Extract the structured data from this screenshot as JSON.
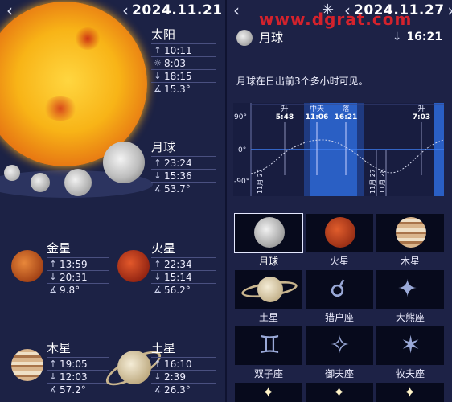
{
  "left": {
    "date": "2024.11.21",
    "sun": {
      "name": "太阳",
      "rise": "10:11",
      "transit": "8:03",
      "set": "18:15",
      "alt": "15.3°"
    },
    "moon": {
      "name": "月球",
      "rise": "23:24",
      "set": "15:36",
      "alt": "53.7°"
    },
    "venus": {
      "name": "金星",
      "rise": "13:59",
      "set": "20:31",
      "alt": "9.8°"
    },
    "mars": {
      "name": "火星",
      "rise": "22:34",
      "set": "15:14",
      "alt": "56.2°"
    },
    "jupiter": {
      "name": "木星",
      "rise": "19:05",
      "set": "12:03",
      "alt": "57.2°"
    },
    "saturn": {
      "name": "土星",
      "rise": "16:10",
      "set": "2:39",
      "alt": "26.3°"
    }
  },
  "right": {
    "date": "2024.11.27",
    "watermark": "www.dgrat.com",
    "object_name": "月球",
    "set_time": "16:21",
    "visibility_text": "月球在日出前3个多小时可见。",
    "chart": {
      "events": [
        {
          "label": "升",
          "time": "5:48"
        },
        {
          "label": "中天",
          "time": "11:06"
        },
        {
          "label": "落",
          "time": "16:21"
        },
        {
          "label": "升",
          "time": "7:03"
        }
      ],
      "y_labels": [
        "90°",
        "0°",
        "-90°"
      ],
      "date_labels": [
        "11月 27",
        "11月 27",
        "11月 28"
      ]
    },
    "grid": [
      {
        "label": "月球"
      },
      {
        "label": "火星"
      },
      {
        "label": "木星"
      },
      {
        "label": "土星"
      },
      {
        "label": "猎户座"
      },
      {
        "label": "大熊座"
      },
      {
        "label": "双子座"
      },
      {
        "label": "御夫座"
      },
      {
        "label": "牧夫座"
      }
    ]
  },
  "colors": {
    "background": "#1b2147",
    "accent": "#2a5fc4",
    "watermark": "#e8222a"
  }
}
